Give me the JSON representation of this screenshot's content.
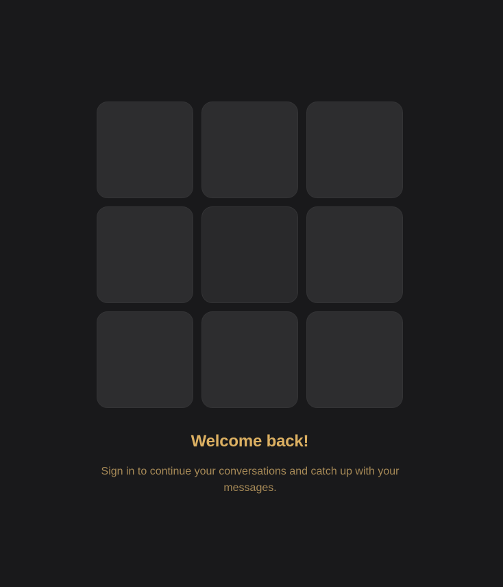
{
  "welcome": {
    "title": "Welcome back!",
    "subtitle": "Sign in to continue your conversations and catch up with your messages."
  },
  "grid": {
    "rows": 3,
    "columns": 3,
    "tiles": [
      {
        "id": 1
      },
      {
        "id": 2
      },
      {
        "id": 3
      },
      {
        "id": 4
      },
      {
        "id": 5
      },
      {
        "id": 6
      },
      {
        "id": 7
      },
      {
        "id": 8
      },
      {
        "id": 9
      }
    ]
  },
  "colors": {
    "background": "#19191b",
    "tile": "#2d2d2f",
    "tile_alt": "#29292b",
    "title": "#dcb062",
    "subtitle": "#a78a57"
  }
}
